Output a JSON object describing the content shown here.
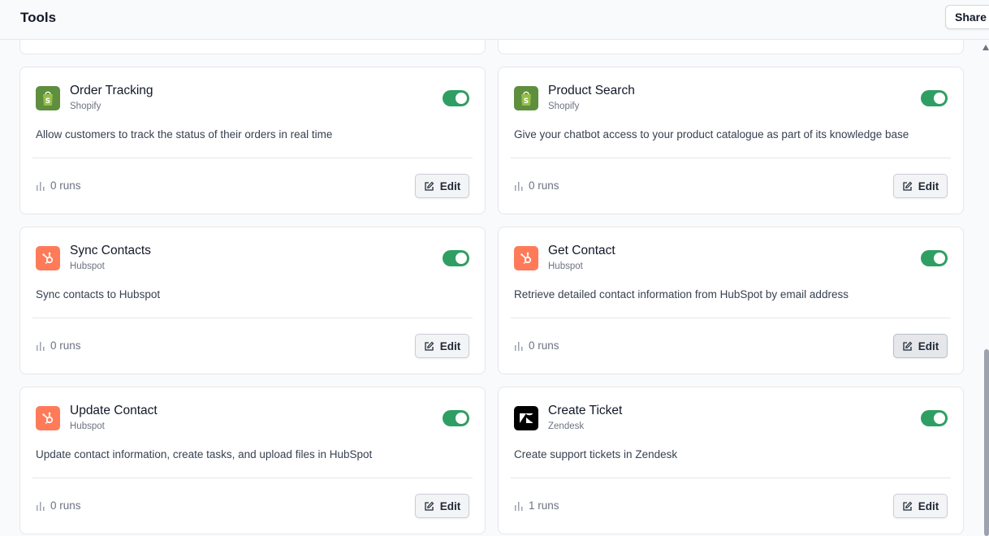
{
  "header": {
    "title": "Tools",
    "share_label": "Share l"
  },
  "tools": [
    {
      "title": "Order Tracking",
      "provider": "Shopify",
      "provider_icon": "shopify-icon",
      "description": "Allow customers to track the status of their orders in real time",
      "runs": "0 runs",
      "enabled": true,
      "edit_label": "Edit"
    },
    {
      "title": "Product Search",
      "provider": "Shopify",
      "provider_icon": "shopify-icon",
      "description": "Give your chatbot access to your product catalogue as part of its knowledge base",
      "runs": "0 runs",
      "enabled": true,
      "edit_label": "Edit"
    },
    {
      "title": "Sync Contacts",
      "provider": "Hubspot",
      "provider_icon": "hubspot-icon",
      "description": "Sync contacts to Hubspot",
      "runs": "0 runs",
      "enabled": true,
      "edit_label": "Edit"
    },
    {
      "title": "Get Contact",
      "provider": "Hubspot",
      "provider_icon": "hubspot-icon",
      "description": "Retrieve detailed contact information from HubSpot by email address",
      "runs": "0 runs",
      "enabled": true,
      "edit_label": "Edit"
    },
    {
      "title": "Update Contact",
      "provider": "Hubspot",
      "provider_icon": "hubspot-icon",
      "description": "Update contact information, create tasks, and upload files in HubSpot",
      "runs": "0 runs",
      "enabled": true,
      "edit_label": "Edit"
    },
    {
      "title": "Create Ticket",
      "provider": "Zendesk",
      "provider_icon": "zendesk-icon",
      "description": "Create support tickets in Zendesk",
      "runs": "1 runs",
      "enabled": true,
      "edit_label": "Edit"
    }
  ],
  "colors": {
    "shopify": "#5e8e3e",
    "hubspot": "#ff7a59",
    "zendesk": "#000000",
    "toggle_on": "#2f9e63"
  }
}
